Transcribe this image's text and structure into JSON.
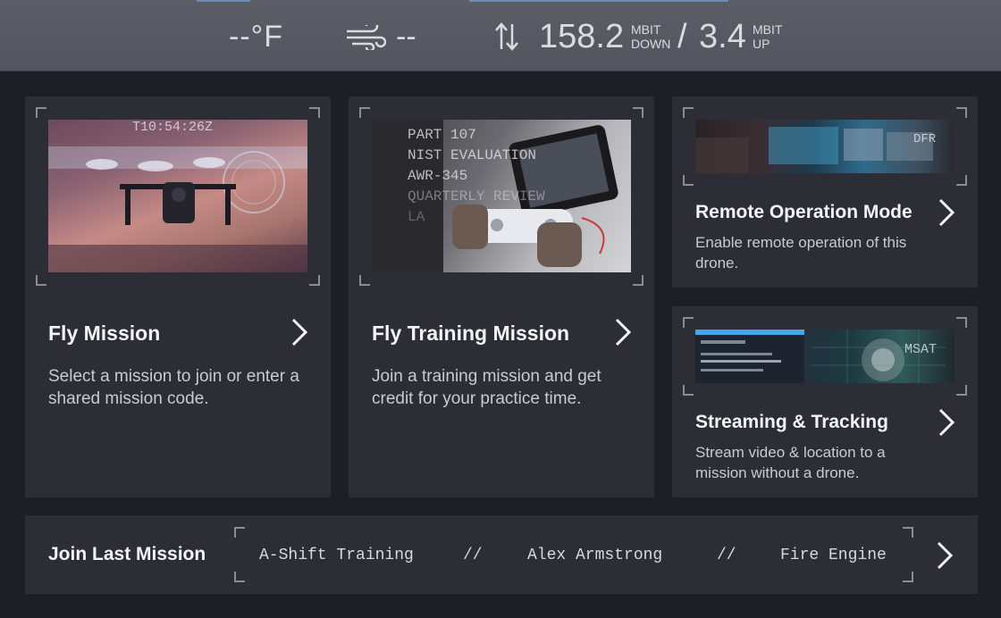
{
  "status": {
    "temperature": "--°F",
    "wind": "--",
    "download_speed": "158.2",
    "download_unit_line1": "MBIT",
    "download_unit_line2": "DOWN",
    "separator": "/",
    "upload_speed": "3.4",
    "upload_unit_line1": "MBIT",
    "upload_unit_line2": "UP"
  },
  "cards": {
    "fly_mission": {
      "title": "Fly Mission",
      "description": "Select a mission to join or enter a shared mission code.",
      "thumb_overlay": "T10:54:26Z"
    },
    "fly_training": {
      "title": "Fly Training Mission",
      "description": "Join a training mission and get credit for your practice time.",
      "thumb_lines": [
        "PART 107",
        "NIST EVALUATION",
        "AWR-345",
        "QUARTERLY REVIEW",
        "LA"
      ]
    },
    "remote_operation": {
      "title": "Remote Operation Mode",
      "description": "Enable remote operation of this drone.",
      "thumb_overlay": "DFR"
    },
    "streaming": {
      "title": "Streaming & Tracking",
      "description": "Stream video & location to a mission without a drone.",
      "thumb_overlay": "MSAT"
    }
  },
  "join_last_mission": {
    "label": "Join Last Mission",
    "mission": "A-Shift Training",
    "separator": "//",
    "pilot": "Alex Armstrong",
    "unit": "Fire Engine"
  },
  "colors": {
    "background": "#1e1f25",
    "card": "#2c2d35",
    "topbar": "#575a62",
    "bracket": "#8b8d95"
  }
}
